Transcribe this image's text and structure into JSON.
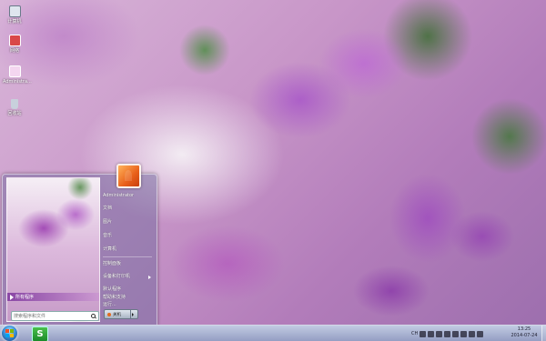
{
  "desktop": {
    "icons": [
      {
        "label": "计算机",
        "color": "#dfe6ee"
      },
      {
        "label": "网络",
        "color": "#d94848"
      },
      {
        "label": "Administra...",
        "color": "#f4d6f0"
      },
      {
        "label": "回收站",
        "color": "#c8d0dc"
      }
    ]
  },
  "start_menu": {
    "all_programs": "所有程序",
    "search_placeholder": "搜索程序和文件",
    "right_items": [
      "Administrator",
      "文档",
      "图片",
      "音乐",
      "计算机",
      "控制面板",
      "设备和打印机",
      "默认程序",
      "帮助和支持",
      "运行..."
    ],
    "shutdown_label": "关机"
  },
  "taskbar": {
    "app_label": "S",
    "tray_text": "CH",
    "time": "13:25",
    "date": "2014-07-24"
  },
  "colors": {
    "accent": "#8a4fb0",
    "taskbar": "#a8b2d4"
  }
}
